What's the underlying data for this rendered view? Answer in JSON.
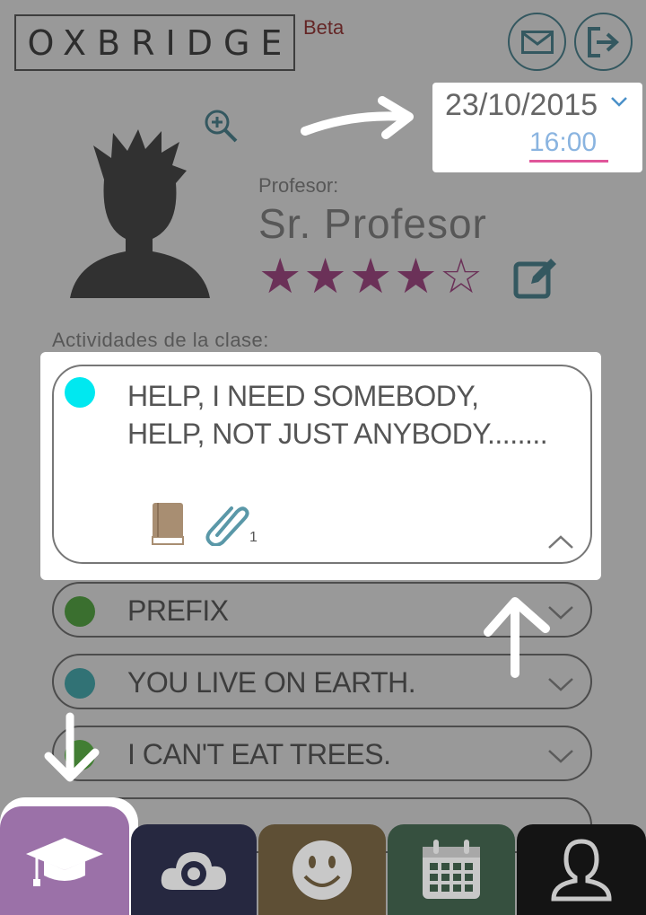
{
  "header": {
    "logo": "OXBRIDGE",
    "beta": "Beta",
    "icons": {
      "mail": "mail-icon",
      "logout": "logout-icon"
    }
  },
  "datetime": {
    "date": "23/10/2015",
    "time": "16:00"
  },
  "profile": {
    "label": "Profesor:",
    "name": "Sr. Profesor",
    "rating": 4,
    "rating_max": 5,
    "star_color": "#9a1a70"
  },
  "activities": {
    "section_label": "Actividades de la clase:",
    "expanded": {
      "text": "HELP, I NEED SOMEBODY, HELP, NOT JUST ANYBODY........",
      "color": "#00e8f0",
      "attachment_count": "1"
    },
    "items": [
      {
        "label": "PREFIX",
        "color": "#2ea316"
      },
      {
        "label": "YOU LIVE ON EARTH.",
        "color": "#1aa8b0"
      },
      {
        "label": "I CAN'T EAT TREES.",
        "color": "#3fc41e"
      }
    ]
  },
  "tabs": [
    {
      "name": "course",
      "icon": "graduation-cap-icon",
      "color": "#9b71a8"
    },
    {
      "name": "cloud",
      "icon": "cloud-eye-icon",
      "color": "#262840"
    },
    {
      "name": "smile",
      "icon": "smiley-icon",
      "color": "#5e4f35"
    },
    {
      "name": "calendar",
      "icon": "calendar-icon",
      "color": "#36503f"
    },
    {
      "name": "user",
      "icon": "user-icon",
      "color": "#141414"
    }
  ]
}
